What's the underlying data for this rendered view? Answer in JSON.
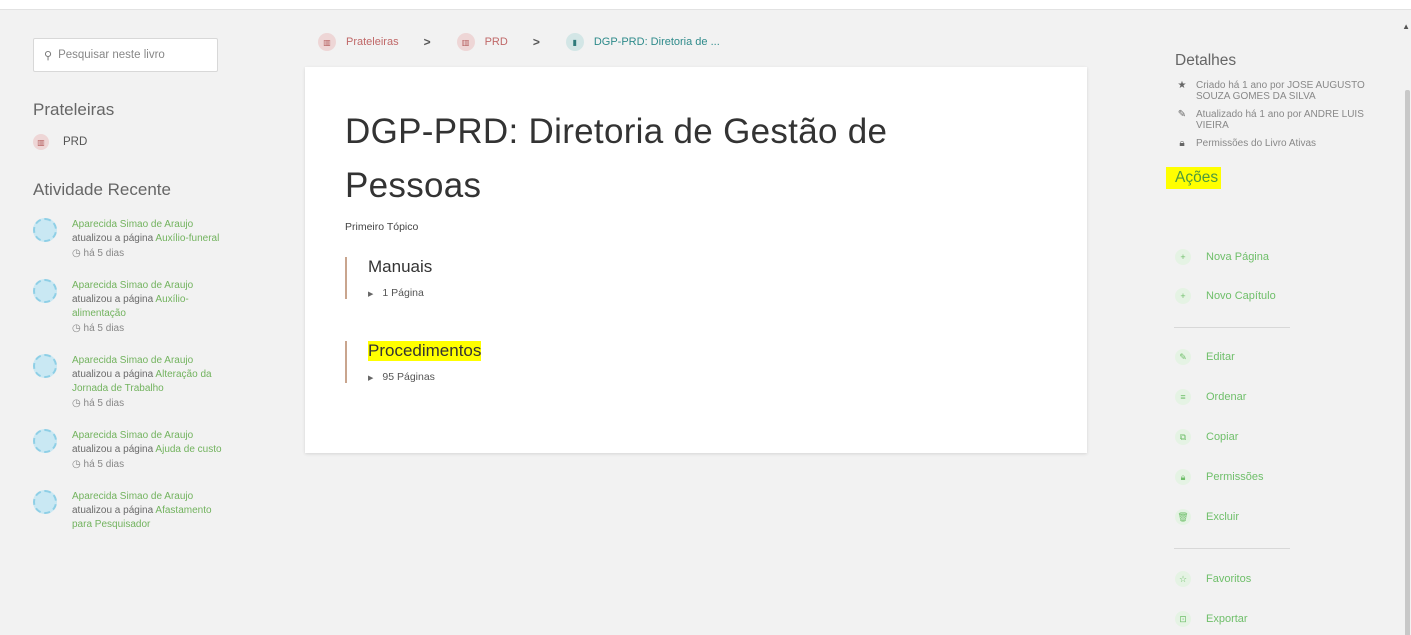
{
  "search": {
    "placeholder": "Pesquisar neste livro"
  },
  "left": {
    "shelves_title": "Prateleiras",
    "shelf": "PRD",
    "activity_title": "Atividade Recente",
    "activities": [
      {
        "user": "Aparecida Simao de Araujo",
        "action": "atualizou a página",
        "page": "Auxílio-funeral",
        "time": "há 5 dias"
      },
      {
        "user": "Aparecida Simao de Araujo",
        "action": "atualizou a página",
        "page": "Auxílio-alimentação",
        "time": "há 5 dias"
      },
      {
        "user": "Aparecida Simao de Araujo",
        "action": "atualizou a página",
        "page": "Alteração da Jornada de Trabalho",
        "time": "há 5 dias"
      },
      {
        "user": "Aparecida Simao de Araujo",
        "action": "atualizou a página",
        "page": "Ajuda de custo",
        "time": "há 5 dias"
      },
      {
        "user": "Aparecida Simao de Araujo",
        "action": "atualizou a página",
        "page": "Afastamento para Pesquisador",
        "time": ""
      }
    ]
  },
  "breadcrumb": {
    "items": [
      "Prateleiras",
      "PRD",
      "DGP-PRD: Diretoria de ..."
    ]
  },
  "book": {
    "title": "DGP-PRD: Diretoria de Gestão de Pessoas",
    "description": "Primeiro Tópico",
    "chapters": [
      {
        "name": "Manuais",
        "count": "1 Página"
      },
      {
        "name": "Procedimentos",
        "count": "95 Páginas"
      }
    ]
  },
  "details": {
    "title": "Detalhes",
    "created": "Criado há 1 ano por JOSE AUGUSTO SOUZA GOMES DA SILVA",
    "updated": "Atualizado há 1 ano por ANDRE LUIS VIEIRA",
    "permissions": "Permissões do Livro Ativas"
  },
  "actions": {
    "title": "Ações",
    "new_page": "Nova Página",
    "new_chapter": "Novo Capítulo",
    "edit": "Editar",
    "sort": "Ordenar",
    "copy": "Copiar",
    "permissions": "Permissões",
    "delete": "Excluir",
    "favorites": "Favoritos",
    "export": "Exportar"
  },
  "colors": {
    "accent_green": "#6fbf6a",
    "shelf_red": "#c06868",
    "book_teal": "#2f8b8b",
    "highlight": "#ffff00"
  }
}
